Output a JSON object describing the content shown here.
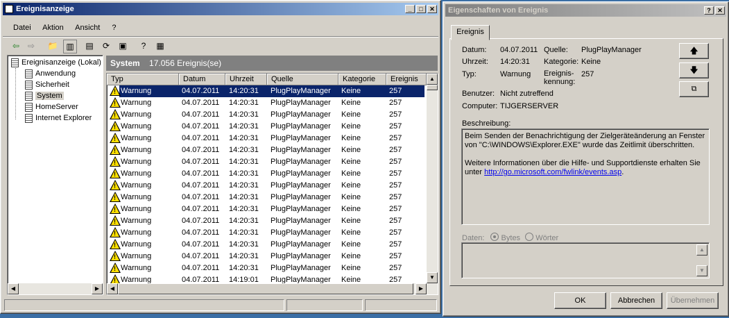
{
  "main": {
    "title": "Ereignisanzeige",
    "menu": [
      "Datei",
      "Aktion",
      "Ansicht",
      "?"
    ],
    "tree": {
      "root": "Ereignisanzeige (Lokal)",
      "items": [
        "Anwendung",
        "Sicherheit",
        "System",
        "HomeServer",
        "Internet Explorer"
      ],
      "selected": "System"
    },
    "panel_title": "System",
    "panel_count": "17.056 Ereignis(se)",
    "columns": [
      "Typ",
      "Datum",
      "Uhrzeit",
      "Quelle",
      "Kategorie",
      "Ereignis"
    ],
    "rows": [
      [
        "Warnung",
        "04.07.2011",
        "14:20:31",
        "PlugPlayManager",
        "Keine",
        "257"
      ],
      [
        "Warnung",
        "04.07.2011",
        "14:20:31",
        "PlugPlayManager",
        "Keine",
        "257"
      ],
      [
        "Warnung",
        "04.07.2011",
        "14:20:31",
        "PlugPlayManager",
        "Keine",
        "257"
      ],
      [
        "Warnung",
        "04.07.2011",
        "14:20:31",
        "PlugPlayManager",
        "Keine",
        "257"
      ],
      [
        "Warnung",
        "04.07.2011",
        "14:20:31",
        "PlugPlayManager",
        "Keine",
        "257"
      ],
      [
        "Warnung",
        "04.07.2011",
        "14:20:31",
        "PlugPlayManager",
        "Keine",
        "257"
      ],
      [
        "Warnung",
        "04.07.2011",
        "14:20:31",
        "PlugPlayManager",
        "Keine",
        "257"
      ],
      [
        "Warnung",
        "04.07.2011",
        "14:20:31",
        "PlugPlayManager",
        "Keine",
        "257"
      ],
      [
        "Warnung",
        "04.07.2011",
        "14:20:31",
        "PlugPlayManager",
        "Keine",
        "257"
      ],
      [
        "Warnung",
        "04.07.2011",
        "14:20:31",
        "PlugPlayManager",
        "Keine",
        "257"
      ],
      [
        "Warnung",
        "04.07.2011",
        "14:20:31",
        "PlugPlayManager",
        "Keine",
        "257"
      ],
      [
        "Warnung",
        "04.07.2011",
        "14:20:31",
        "PlugPlayManager",
        "Keine",
        "257"
      ],
      [
        "Warnung",
        "04.07.2011",
        "14:20:31",
        "PlugPlayManager",
        "Keine",
        "257"
      ],
      [
        "Warnung",
        "04.07.2011",
        "14:20:31",
        "PlugPlayManager",
        "Keine",
        "257"
      ],
      [
        "Warnung",
        "04.07.2011",
        "14:20:31",
        "PlugPlayManager",
        "Keine",
        "257"
      ],
      [
        "Warnung",
        "04.07.2011",
        "14:20:31",
        "PlugPlayManager",
        "Keine",
        "257"
      ],
      [
        "Warnung",
        "04.07.2011",
        "14:19:01",
        "PlugPlayManager",
        "Keine",
        "257"
      ]
    ],
    "selected_row": 0
  },
  "props": {
    "title": "Eigenschaften von Ereignis",
    "tab": "Ereignis",
    "labels": {
      "datum": "Datum:",
      "uhrzeit": "Uhrzeit:",
      "typ": "Typ:",
      "quelle": "Quelle:",
      "kategorie": "Kategorie:",
      "kennung": "Ereignis-\nkennung:",
      "benutzer": "Benutzer:",
      "computer": "Computer:",
      "beschreibung": "Beschreibung:",
      "daten": "Daten:",
      "bytes": "Bytes",
      "woerter": "Wörter"
    },
    "values": {
      "datum": "04.07.2011",
      "uhrzeit": "14:20:31",
      "typ": "Warnung",
      "quelle": "PlugPlayManager",
      "kategorie": "Keine",
      "kennung": "257",
      "benutzer": "Nicht zutreffend",
      "computer": "TIJGERSERVER"
    },
    "description_1": "Beim Senden der Benachrichtigung der Zielgeräteänderung an Fenster von \"C:\\WINDOWS\\Explorer.EXE\" wurde das Zeitlimit überschritten.",
    "description_2": "Weitere Informationen über die Hilfe- und Supportdienste erhalten Sie unter ",
    "description_link": "http://go.microsoft.com/fwlink/events.asp",
    "description_end": ".",
    "buttons": {
      "ok": "OK",
      "cancel": "Abbrechen",
      "apply": "Übernehmen"
    }
  }
}
